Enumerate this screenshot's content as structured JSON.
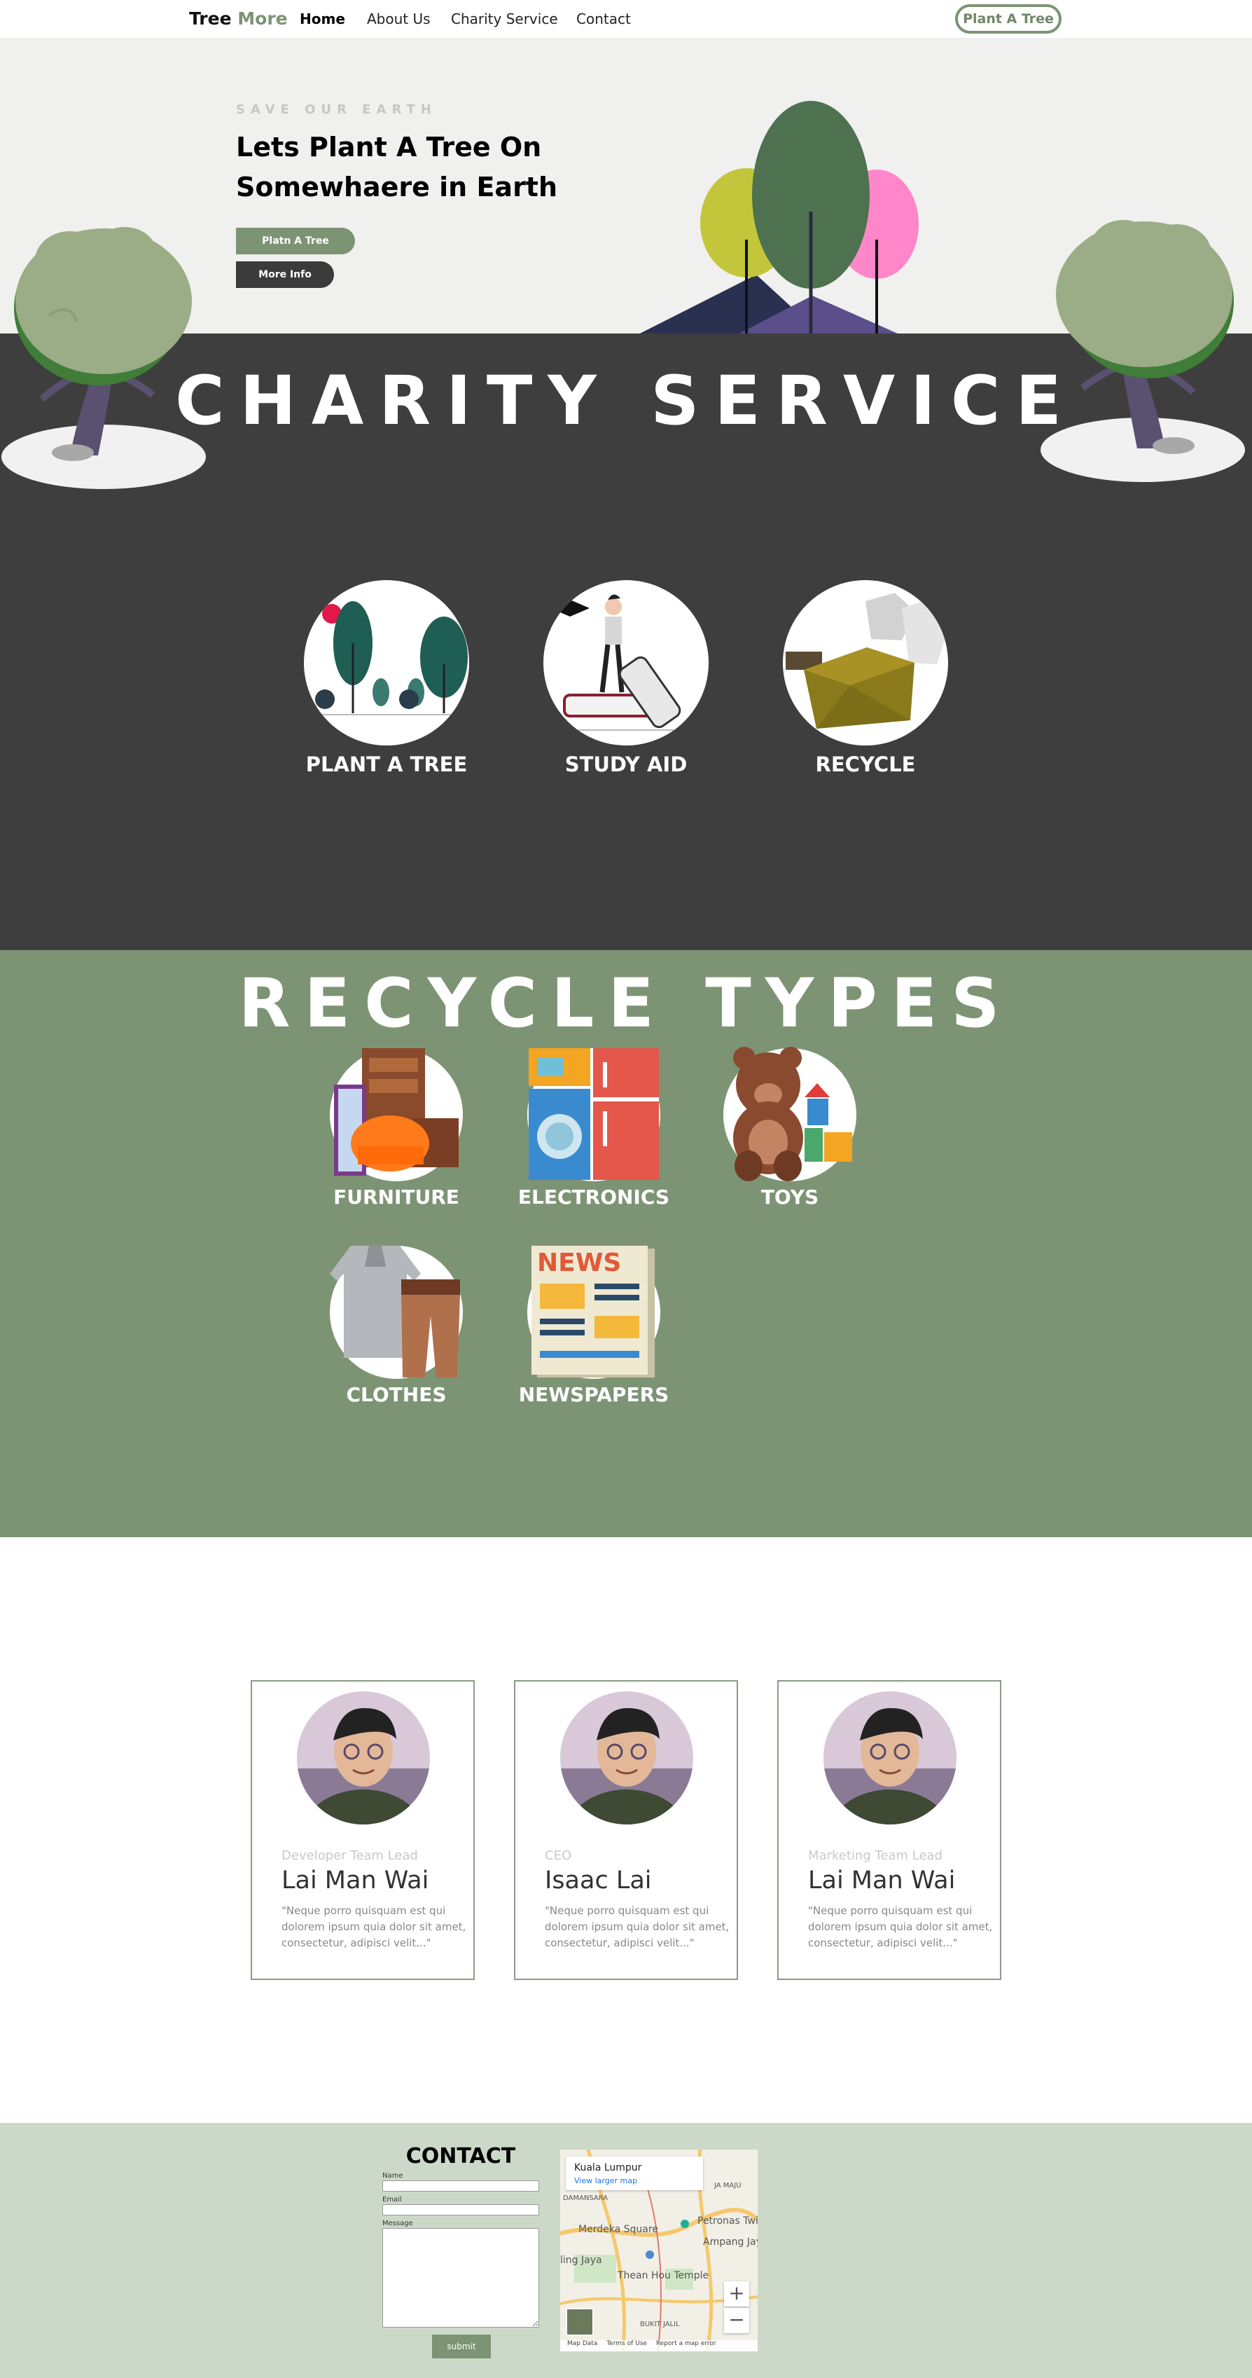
{
  "nav": {
    "brand_part1": "Tree",
    "brand_part2": "More",
    "links": [
      "Home",
      "About Us",
      "Charity Service",
      "Contact"
    ],
    "cta": "Plant A Tree"
  },
  "hero": {
    "kicker": "SAVE OUR EARTH",
    "title": "Lets Plant A Tree On Somewhaere in Earth",
    "btn_primary": "Platn A Tree",
    "btn_secondary": "More Info"
  },
  "charity": {
    "title": "CHARITY SERVICE",
    "services": [
      "PLANT A TREE",
      "STUDY AID",
      "RECYCLE"
    ]
  },
  "recycle": {
    "title": "RECYCLE TYPES",
    "types": [
      "FURNITURE",
      "ELECTRONICS",
      "TOYS",
      "CLOTHES",
      "NEWSPAPERS"
    ]
  },
  "team": {
    "members": [
      {
        "role": "Developer Team Lead",
        "name": "Lai Man Wai",
        "quote": "\"Neque porro quisquam est qui dolorem ipsum quia dolor sit amet, consectetur, adipisci velit...\""
      },
      {
        "role": "CEO",
        "name": "Isaac Lai",
        "quote": "\"Neque porro quisquam est qui dolorem ipsum quia dolor sit amet, consectetur, adipisci velit...\""
      },
      {
        "role": "Marketing Team Lead",
        "name": "Lai Man Wai",
        "quote": "\"Neque porro quisquam est qui dolorem ipsum quia dolor sit amet, consectetur, adipisci velit...\""
      }
    ]
  },
  "contact": {
    "title": "CONTACT",
    "name_label": "Name",
    "email_label": "Email",
    "message_label": "Message",
    "submit": "submit",
    "map": {
      "place": "Kuala Lumpur",
      "link": "View larger map",
      "labels": [
        "Merdeka Square",
        "Petronas Twin T",
        "Ampang Jay",
        "ling Jaya",
        "Thean Hou Temple",
        "BUKIT JALIL",
        "DAMANSARA",
        "JA MAJU"
      ],
      "footer": [
        "Map Data",
        "Terms of Use",
        "Report a map error"
      ],
      "zoom_in": "+",
      "zoom_out": "−"
    }
  },
  "colors": {
    "accent": "#7d9474",
    "dark": "#3e3e3e",
    "hero_bg": "#f0f0ee",
    "contact_bg": "#cdd9c8"
  }
}
